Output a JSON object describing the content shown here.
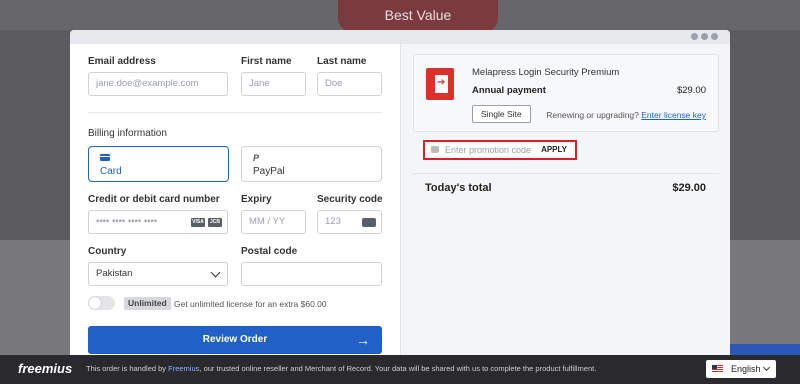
{
  "banner": {
    "best_value": "Best Value"
  },
  "form": {
    "email": {
      "label": "Email address",
      "placeholder": "jane.doe@example.com"
    },
    "first_name": {
      "label": "First name",
      "placeholder": "Jane"
    },
    "last_name": {
      "label": "Last name",
      "placeholder": "Doe"
    },
    "billing_title": "Billing information",
    "payment_methods": [
      {
        "label": "Card",
        "icon": "credit-card-icon",
        "selected": true
      },
      {
        "label": "PayPal",
        "icon": "paypal-icon",
        "selected": false
      }
    ],
    "card_number": {
      "label": "Credit or debit card number",
      "placeholder": "•••• •••• •••• ••••",
      "brands": [
        "VISA",
        "JCB"
      ]
    },
    "expiry": {
      "label": "Expiry",
      "placeholder": "MM / YY"
    },
    "security_code": {
      "label": "Security code",
      "placeholder": "123"
    },
    "country": {
      "label": "Country",
      "value": "Pakistan"
    },
    "postal_code": {
      "label": "Postal code",
      "placeholder": ""
    },
    "unlimited": {
      "badge": "Unlimited",
      "text": "Get unlimited license for an extra $60.00",
      "enabled": false
    },
    "review_button": "Review Order"
  },
  "summary": {
    "product_name": "Melapress Login Security Premium",
    "plan": "Annual payment",
    "price": "$29.00",
    "site_option": "Single Site",
    "renew_text": "Renewing or upgrading?",
    "renew_link": "Enter license key",
    "promo": {
      "placeholder": "Enter promotion code",
      "apply": "APPLY"
    },
    "total_label": "Today's total",
    "total_amount": "$29.00"
  },
  "footer": {
    "brand": "freemius",
    "text_before": "This order is handled by ",
    "text_link": "Freemius",
    "text_after": ", our trusted online reseller and Merchant of Record. Your data will be shared with us to complete the product fulfillment.",
    "language": "English"
  },
  "colors": {
    "accent": "#2160c4",
    "highlight": "#d4202a",
    "brand_red": "#d8322b"
  }
}
